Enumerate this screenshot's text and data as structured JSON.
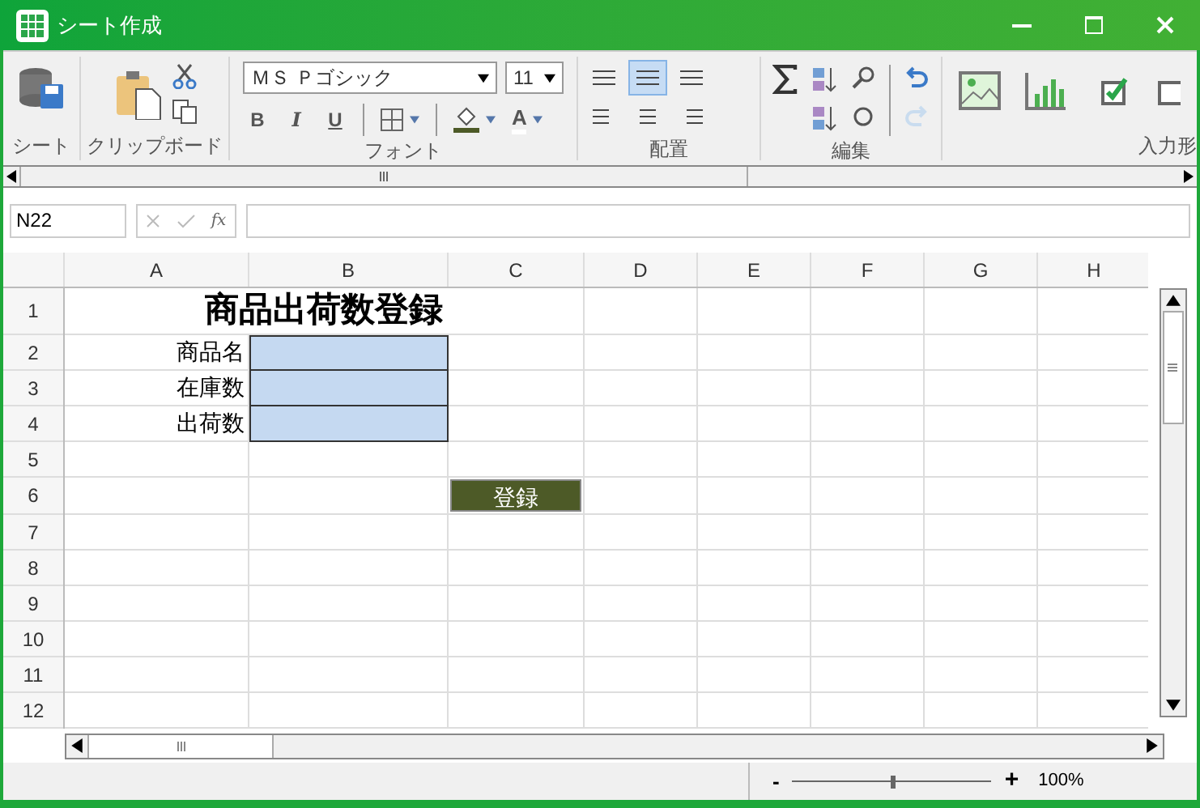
{
  "window": {
    "title": "シート作成"
  },
  "ribbon": {
    "groups": [
      {
        "label": "シート"
      },
      {
        "label": "クリップボード"
      },
      {
        "label": "フォント"
      },
      {
        "label": "配置"
      },
      {
        "label": "編集"
      },
      {
        "label": "入力形"
      }
    ],
    "font": {
      "name": "ＭＳ Ｐゴシック",
      "size": "11",
      "styles": [
        "B",
        "I",
        "U"
      ],
      "color_letter": "A"
    },
    "alignment": [
      {
        "selected": false
      },
      {
        "selected": true
      },
      {
        "selected": false
      },
      {
        "selected": false
      },
      {
        "selected": false
      },
      {
        "selected": false
      }
    ]
  },
  "formula_bar": {
    "name_box": "N22",
    "function_label": "fx"
  },
  "sheet": {
    "columns": [
      "A",
      "B",
      "C",
      "D",
      "E",
      "F",
      "G",
      "H"
    ],
    "rows": [
      "1",
      "2",
      "3",
      "4",
      "5",
      "6",
      "7",
      "8",
      "9",
      "10",
      "11",
      "12"
    ],
    "title": "商品出荷数登録",
    "fields": [
      {
        "label": "商品名"
      },
      {
        "label": "在庫数"
      },
      {
        "label": "出荷数"
      }
    ],
    "button": "登録"
  },
  "zoom": {
    "minus": "-",
    "plus": "+",
    "level": 0.5,
    "reading": "100%"
  }
}
